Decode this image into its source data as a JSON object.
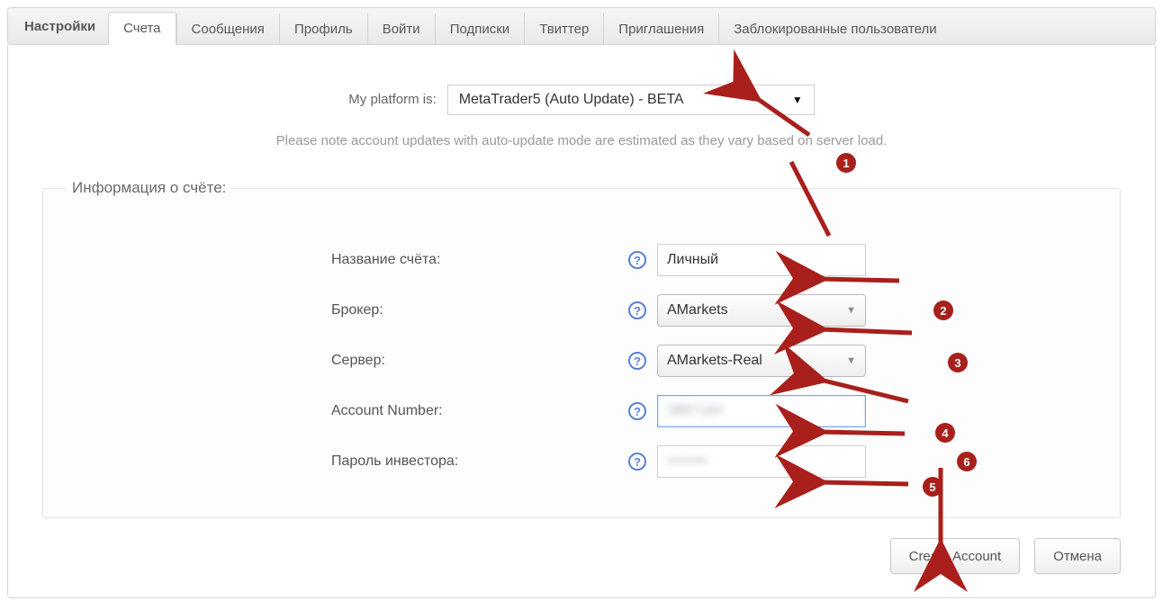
{
  "header": {
    "label": "Настройки",
    "tabs": [
      {
        "id": "accounts",
        "label": "Счета",
        "active": true
      },
      {
        "id": "messages",
        "label": "Сообщения",
        "active": false
      },
      {
        "id": "profile",
        "label": "Профиль",
        "active": false
      },
      {
        "id": "login",
        "label": "Войти",
        "active": false
      },
      {
        "id": "subs",
        "label": "Подписки",
        "active": false
      },
      {
        "id": "twitter",
        "label": "Твиттер",
        "active": false
      },
      {
        "id": "invites",
        "label": "Приглашения",
        "active": false
      },
      {
        "id": "blocked",
        "label": "Заблокированные пользователи",
        "active": false
      }
    ]
  },
  "platform": {
    "label": "My platform is:",
    "value": "MetaTrader5 (Auto Update) - BETA"
  },
  "note": "Please note account updates with auto-update mode are estimated as they vary based on server load.",
  "fieldset_legend": "Информация о счёте:",
  "fields": {
    "account_name": {
      "label": "Название счёта:",
      "value": "Личный"
    },
    "broker": {
      "label": "Брокер:",
      "value": "AMarkets"
    },
    "server": {
      "label": "Сервер:",
      "value": "AMarkets-Real"
    },
    "account_num": {
      "label": "Account Number:",
      "value": "3887184"
    },
    "investor_pwd": {
      "label": "Пароль инвестора:",
      "value": "••••••••"
    }
  },
  "buttons": {
    "create": "Create Account",
    "cancel": "Отмена"
  },
  "annotations": {
    "1": "1",
    "2": "2",
    "3": "3",
    "4": "4",
    "5": "5",
    "6": "6"
  },
  "colors": {
    "accent": "#a81f1b",
    "help": "#5a7fd6"
  }
}
